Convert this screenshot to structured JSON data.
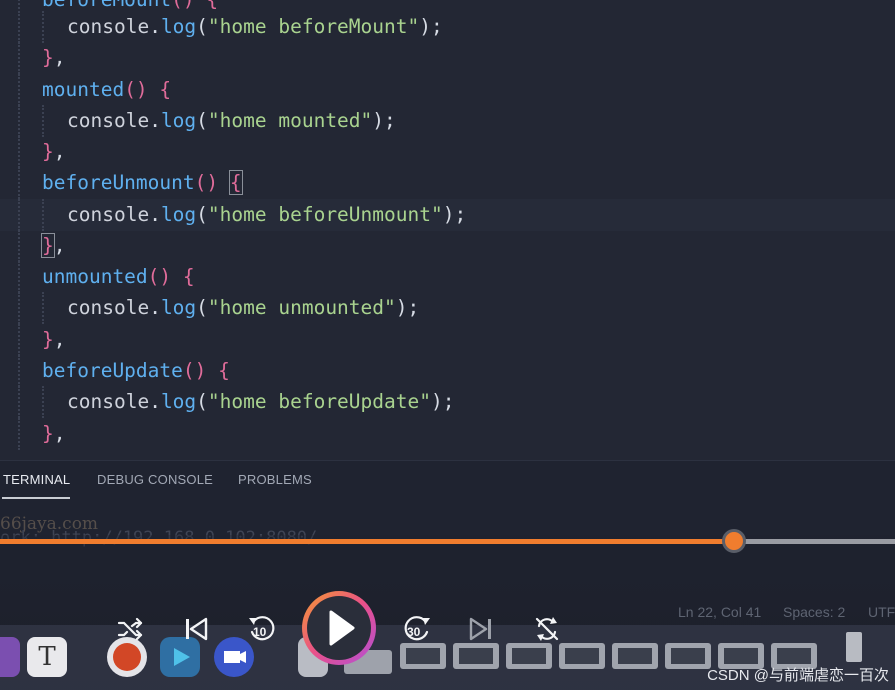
{
  "editor": {
    "lines": [
      {
        "indent": 1,
        "prefix": "",
        "fn": "beforeMount",
        "tail": "() {",
        "partial": true
      },
      {
        "indent": 2,
        "fn": "console.log",
        "arg": "\"home beforeMount\"",
        "end": ");"
      },
      {
        "indent": 1,
        "close": "},"
      },
      {
        "indent": 1,
        "fn": "mounted",
        "tail": "() {"
      },
      {
        "indent": 2,
        "fn": "console.log",
        "arg": "\"home mounted\"",
        "end": ");"
      },
      {
        "indent": 1,
        "close": "},"
      },
      {
        "indent": 1,
        "fn": "beforeUnmount",
        "tail": "() {"
      },
      {
        "indent": 2,
        "fn": "console.log",
        "arg": "\"home beforeUnmount\"",
        "end": ");"
      },
      {
        "indent": 1,
        "close": "},"
      },
      {
        "indent": 1,
        "fn": "unmounted",
        "tail": "() {"
      },
      {
        "indent": 2,
        "fn": "console.log",
        "arg": "\"home unmounted\"",
        "end": ");"
      },
      {
        "indent": 1,
        "close": "},"
      },
      {
        "indent": 1,
        "fn": "beforeUpdate",
        "tail": "() {"
      },
      {
        "indent": 2,
        "fn": "console.log",
        "arg": "\"home beforeUpdate\"",
        "end": ");"
      },
      {
        "indent": 1,
        "close": "},"
      }
    ],
    "console_obj": "console",
    "log_method": "log",
    "strings": {
      "l1": "\"home beforeMount\"",
      "l4": "\"home mounted\"",
      "l7": "\"home beforeUnmount\"",
      "l10": "\"home unmounted\"",
      "l13": "\"home beforeUpdate\""
    },
    "methods": {
      "m3": "mounted",
      "m6": "beforeUnmount",
      "m9": "unmounted",
      "m12": "beforeUpdate"
    }
  },
  "panel": {
    "tabs": [
      {
        "label": "TERMINAL",
        "active": true
      },
      {
        "label": "DEBUG CONSOLE",
        "active": false
      },
      {
        "label": "PROBLEMS",
        "active": false
      }
    ]
  },
  "terminal": {
    "watermark": "66jaya.com",
    "network_line": "ork: http://192.168.0.102:8080/"
  },
  "player": {
    "progress_fraction": 0.82,
    "accent": "#f07d2e",
    "controls": [
      "shuffle-icon",
      "previous-icon",
      "rewind-10-icon",
      "play-icon",
      "forward-30-icon",
      "next-icon",
      "repeat-icon"
    ],
    "rewind_label": "10",
    "forward_label": "30"
  },
  "statusbar": {
    "position": "Ln 22, Col 41",
    "spaces": "Spaces: 2",
    "encoding": "UTF"
  },
  "dock": {
    "t_label": "T"
  },
  "watermark": "CSDN @与前端虐恋一百次"
}
